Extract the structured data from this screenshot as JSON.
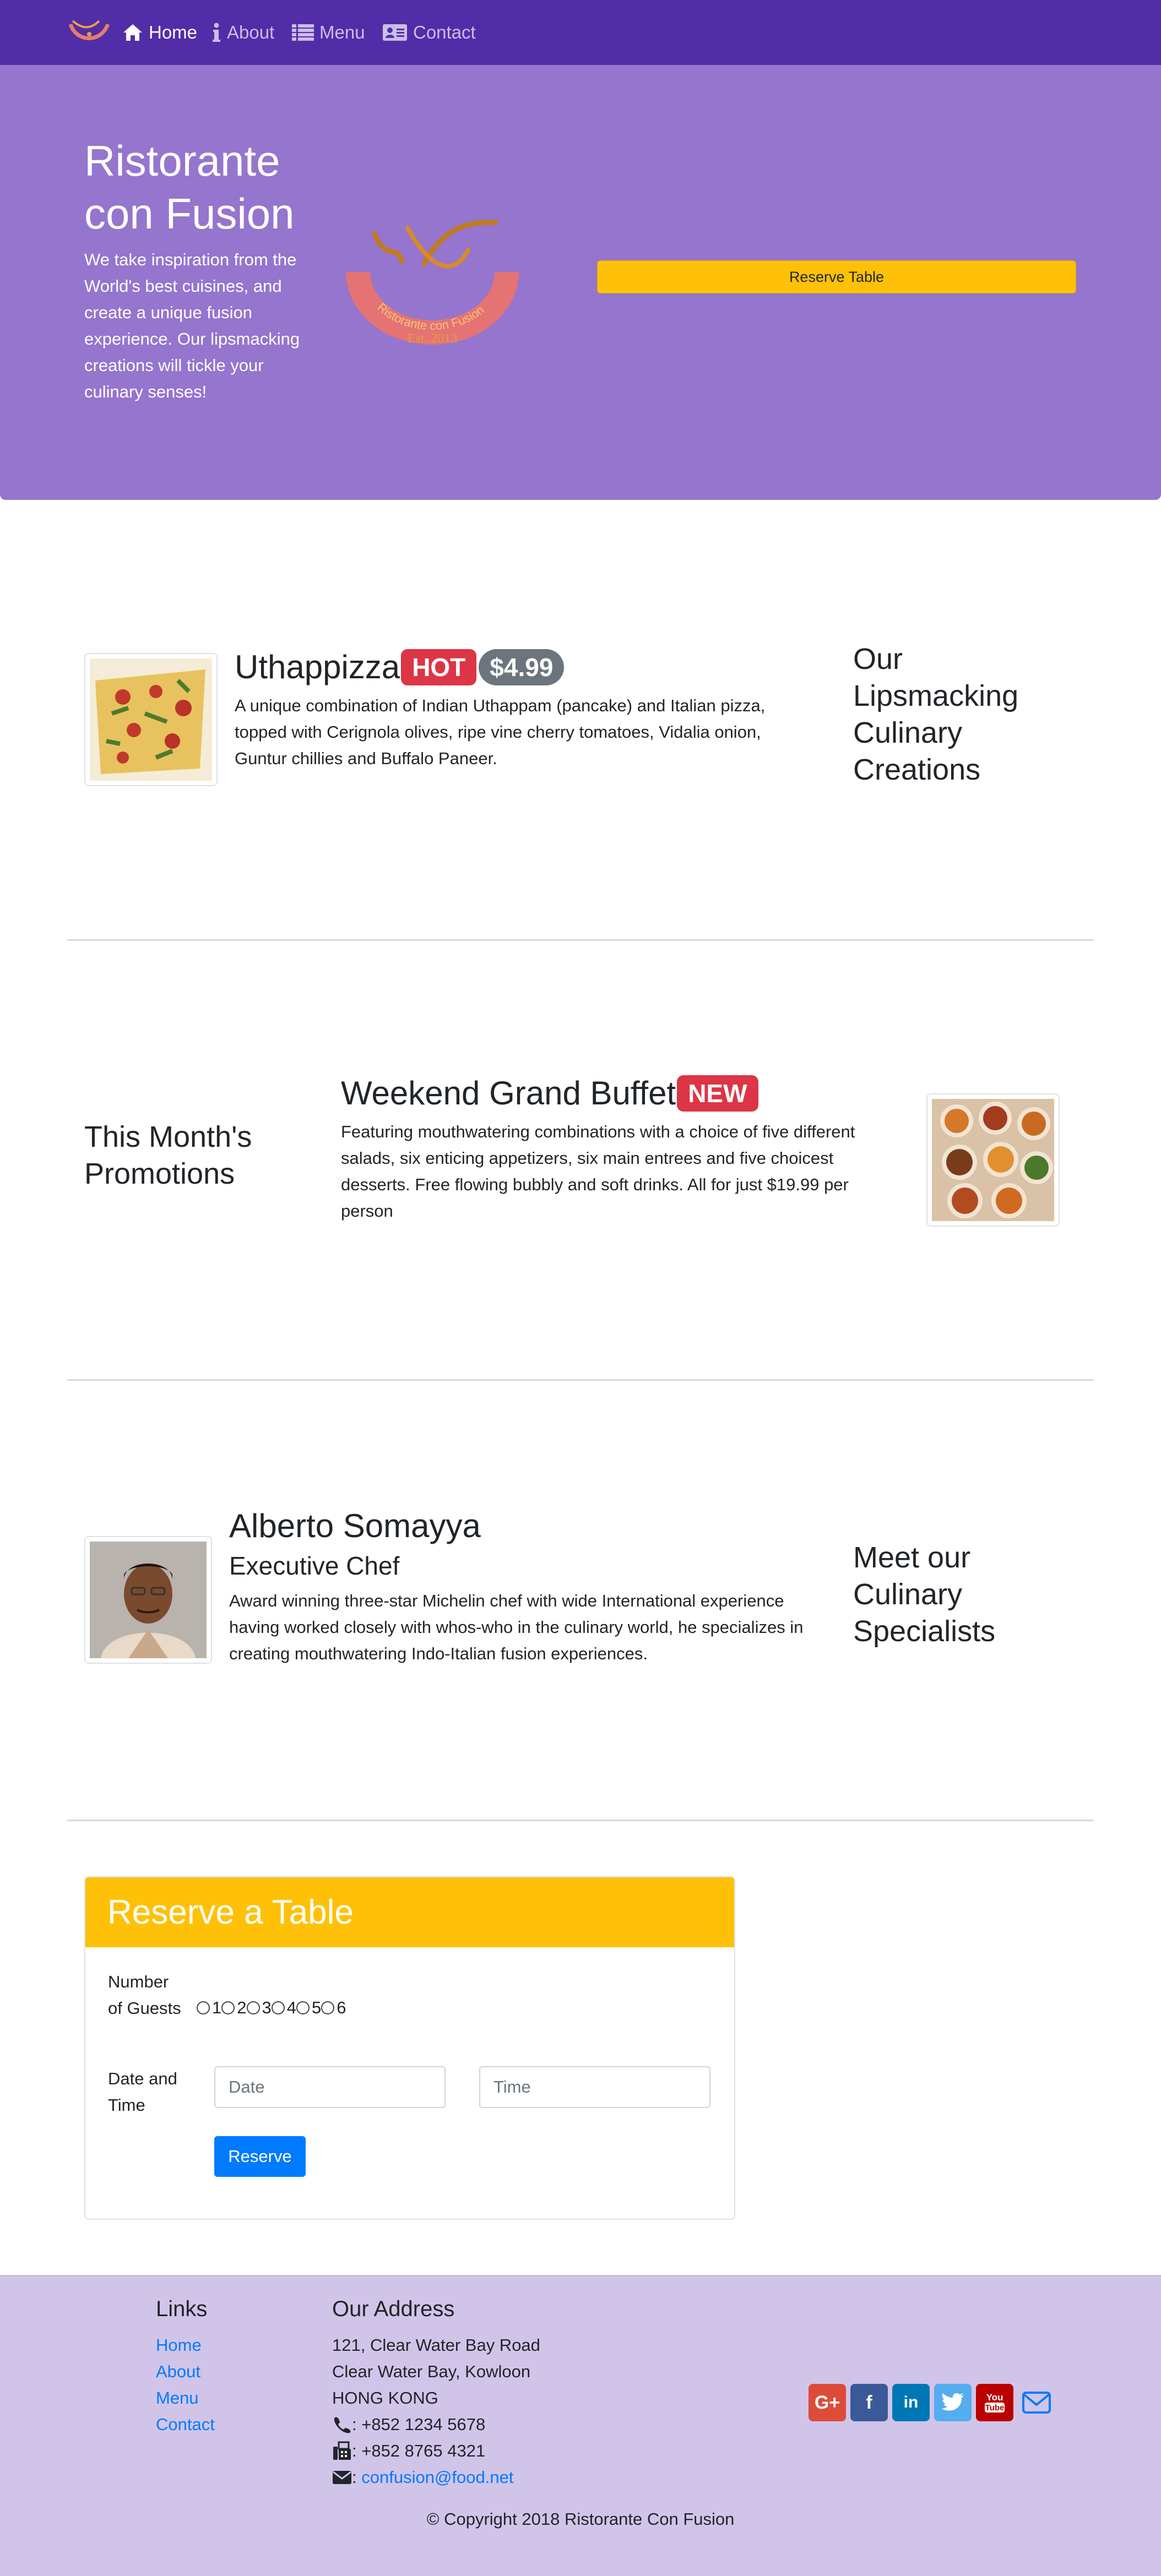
{
  "nav": {
    "items": [
      {
        "label": "Home",
        "icon": "home-icon",
        "active": true
      },
      {
        "label": "About",
        "icon": "info-icon",
        "active": false
      },
      {
        "label": "Menu",
        "icon": "list-icon",
        "active": false
      },
      {
        "label": "Contact",
        "icon": "address-card-icon",
        "active": false
      }
    ]
  },
  "jumbotron": {
    "title": "Ristorante con Fusion",
    "description": "We take inspiration from the World's best cuisines, and create a unique fusion experience. Our lipsmacking creations will tickle your culinary senses!",
    "logo_text": "Ristorante con Fusion",
    "logo_est": "Est. 2013",
    "reserve_button": "Reserve Table"
  },
  "dish": {
    "name": "Uthappizza",
    "badge_hot": "HOT",
    "price": "$4.99",
    "description": "A unique combination of Indian Uthappam (pancake) and Italian pizza, topped with Cerignola olives, ripe vine cherry tomatoes, Vidalia onion, Guntur chillies and Buffalo Paneer.",
    "side_heading": "Our Lipsmacking Culinary Creations"
  },
  "promotion": {
    "side_heading": "This Month's Promotions",
    "name": "Weekend Grand Buffet",
    "badge_new": "NEW",
    "description": "Featuring mouthwatering combinations with a choice of five different salads, six enticing appetizers, six main entrees and five choicest desserts. Free flowing bubbly and soft drinks. All for just $19.99 per person"
  },
  "leader": {
    "name": "Alberto Somayya",
    "designation": "Executive Chef",
    "description": "Award winning three-star Michelin chef with wide International experience having worked closely with whos-who in the culinary world, he specializes in creating mouthwatering Indo-Italian fusion experiences.",
    "side_heading": "Meet our Culinary Specialists"
  },
  "reservation": {
    "header": "Reserve a Table",
    "guests_label": "Number of Guests",
    "guest_options": [
      "1",
      "2",
      "3",
      "4",
      "5",
      "6"
    ],
    "datetime_label": "Date and Time",
    "date_placeholder": "Date",
    "time_placeholder": "Time",
    "submit_label": "Reserve"
  },
  "footer": {
    "links_heading": "Links",
    "links": [
      "Home",
      "About",
      "Menu",
      "Contact"
    ],
    "address_heading": "Our Address",
    "address_lines": [
      "121, Clear Water Bay Road",
      "Clear Water Bay, Kowloon",
      "HONG KONG"
    ],
    "phone": ": +852 1234 5678",
    "fax": ": +852 8765 4321",
    "email_prefix": ": ",
    "email": "confusion@food.net",
    "social": [
      "google-plus-icon",
      "facebook-icon",
      "linkedin-icon",
      "twitter-icon",
      "youtube-icon",
      "mail-icon"
    ],
    "copyright": "© Copyright 2018 Ristorante Con Fusion"
  },
  "colors": {
    "navbar": "#512da8",
    "jumbotron": "#9575cd",
    "footer": "#d1c4e9",
    "warning": "#ffc107",
    "danger": "#dc3545",
    "primary": "#007bff"
  }
}
